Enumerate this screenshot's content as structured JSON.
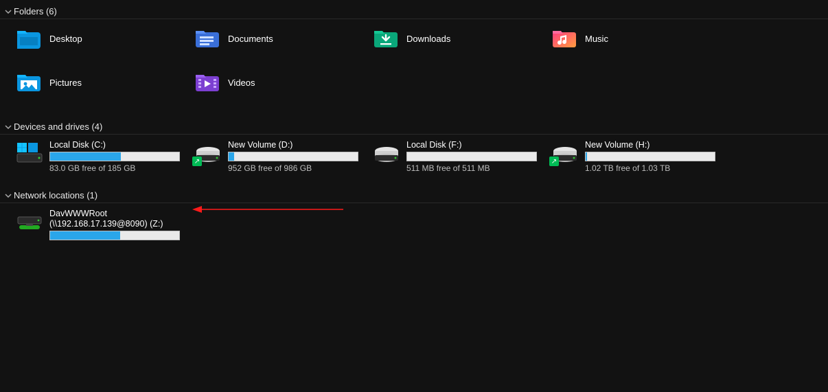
{
  "sections": {
    "folders": {
      "title": "Folders (6)",
      "items": [
        {
          "name": "Desktop",
          "icon": "desktop"
        },
        {
          "name": "Documents",
          "icon": "documents"
        },
        {
          "name": "Downloads",
          "icon": "downloads"
        },
        {
          "name": "Music",
          "icon": "music"
        },
        {
          "name": "Pictures",
          "icon": "pictures"
        },
        {
          "name": "Videos",
          "icon": "videos"
        }
      ]
    },
    "drives": {
      "title": "Devices and drives (4)",
      "items": [
        {
          "name": "Local Disk (C:)",
          "free_text": "83.0 GB free of 185 GB",
          "fill_pct": 55,
          "icon": "os"
        },
        {
          "name": "New Volume (D:)",
          "free_text": "952 GB free of 986 GB",
          "fill_pct": 4,
          "icon": "disk",
          "shortcut": true
        },
        {
          "name": "Local Disk (F:)",
          "free_text": "511 MB free of 511 MB",
          "fill_pct": 0,
          "icon": "disk"
        },
        {
          "name": "New Volume (H:)",
          "free_text": "1.02 TB free of 1.03 TB",
          "fill_pct": 1,
          "icon": "disk",
          "shortcut": true
        }
      ]
    },
    "network": {
      "title": "Network locations (1)",
      "items": [
        {
          "name": "DavWWWRoot",
          "sub": "(\\\\192.168.17.139@8090) (Z:)",
          "fill_pct": 54,
          "icon": "netdrive"
        }
      ]
    }
  }
}
